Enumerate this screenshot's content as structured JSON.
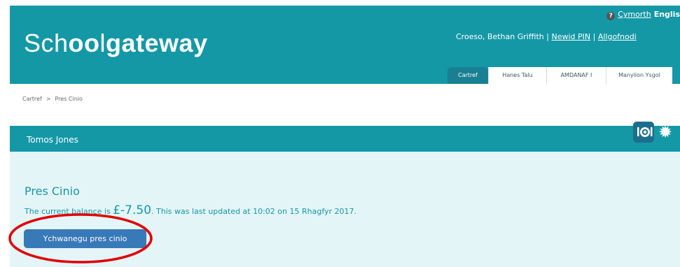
{
  "top": {
    "help": "Cymorth",
    "language": "Englis"
  },
  "brand": {
    "logo_school": "Sch",
    "logo_oo": "oo",
    "logo_l": "l",
    "logo_gateway": "gateway"
  },
  "user": {
    "greeting": "Croeso, Bethan Griffith",
    "separator": "|",
    "change_pin": "Newid PIN",
    "logout": "Allgofnodi"
  },
  "tabs": [
    {
      "label": "Cartref",
      "active": true
    },
    {
      "label": "Hanes Talu",
      "active": false
    },
    {
      "label": "AMDANAF I",
      "active": false
    },
    {
      "label": "Manylion Ysgol",
      "active": false
    }
  ],
  "breadcrumb": {
    "home": "Cartref",
    "separator": ">",
    "current": "Pres Cinio"
  },
  "child": {
    "name": "Tomos Jones",
    "icons": [
      "meal-icon",
      "sun-icon"
    ]
  },
  "panel": {
    "title": "Pres Cinio",
    "balance_prefix": "The current balance is ",
    "balance_amount": "£-7.50",
    "balance_suffix": ". This was last updated at 10:02 on 15 Rhagfyr 2017.",
    "button_label": "Ychwanegu pres cinio"
  },
  "colors": {
    "header": "#1498a6",
    "active_tab": "#1a7f92",
    "panel_bg": "#e4f5f8",
    "button": "#3879b8",
    "annotation": "#e00000"
  }
}
